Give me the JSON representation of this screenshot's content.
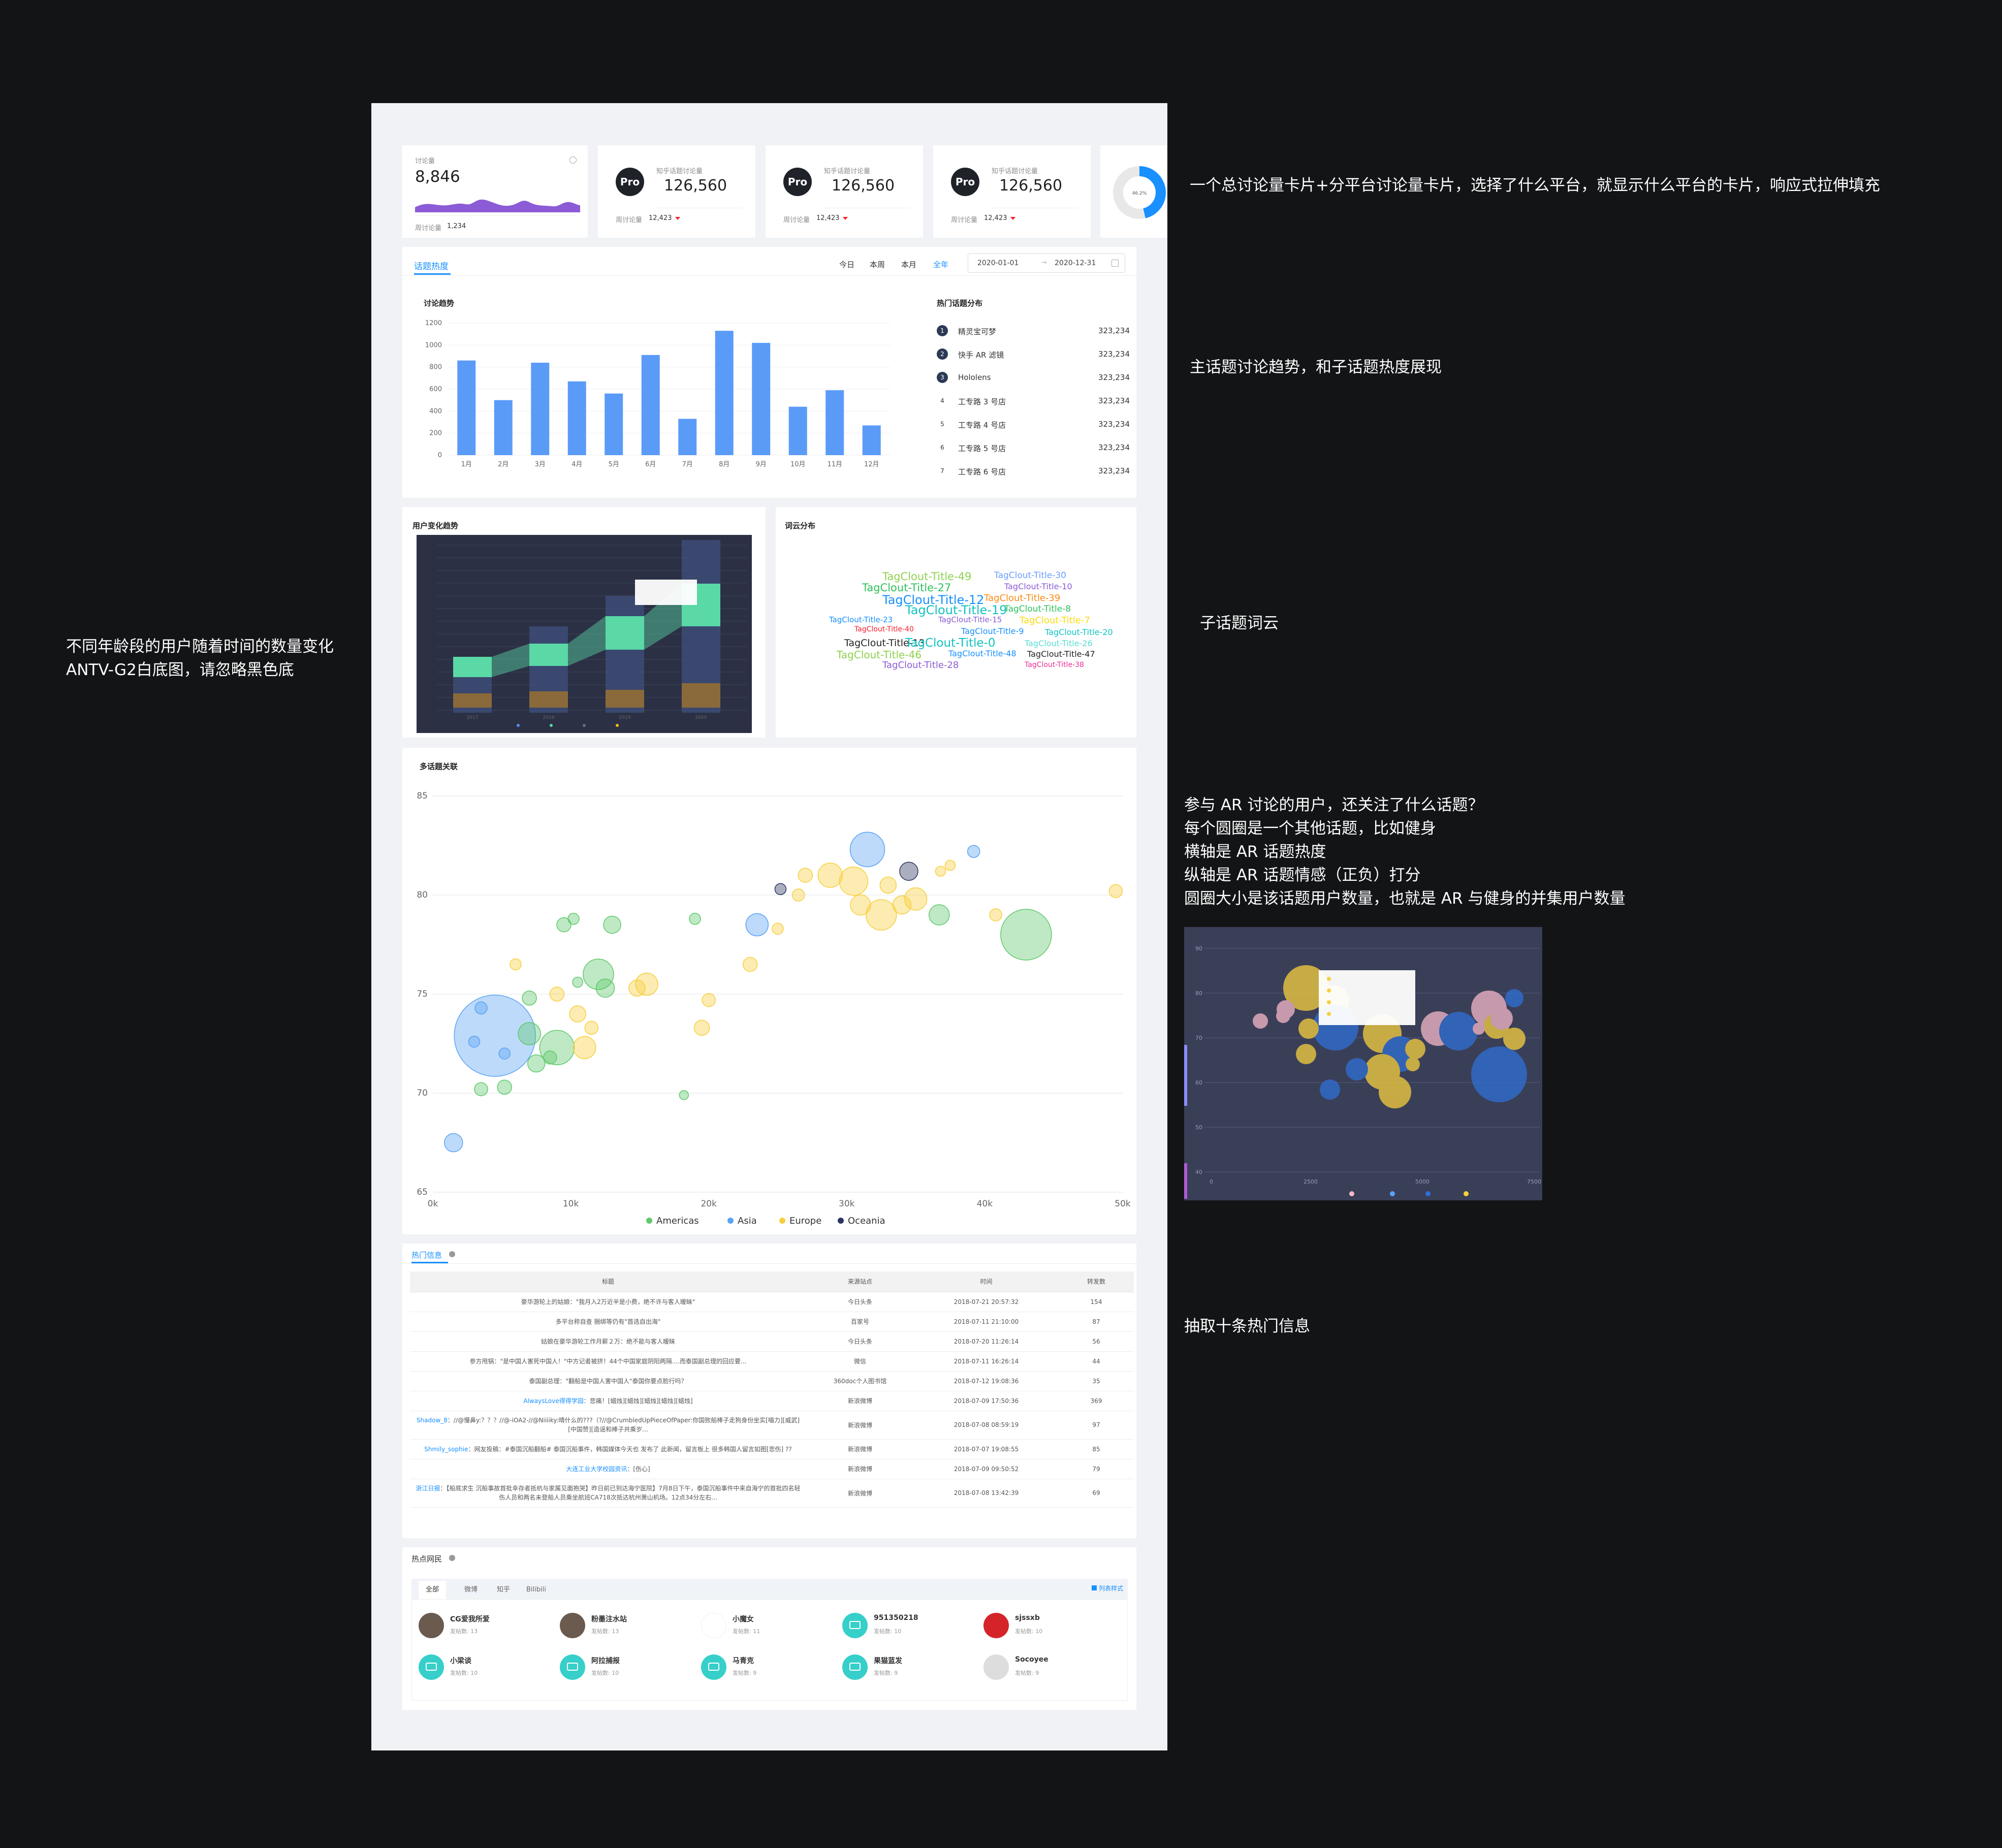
{
  "annotations": {
    "cards_note": "一个总讨论量卡片+分平台讨论量卡片，选择了什么平台，就显示什么平台的卡片，响应式拉伸填充",
    "trend_note": "主话题讨论趋势，和子话题热度展现",
    "user_trend_note": "不同年龄段的用户随着时间的数量变化\nANTV-G2白底图，请忽略黑色底",
    "wordcloud_note": "子话题词云",
    "bubble_note": "参与 AR 讨论的用户，还关注了什么话题？\n每个圆圈是一个其他话题，比如健身\n横轴是 AR 话题热度\n纵轴是 AR 话题情感（正负）打分\n圆圈大小是该话题用户数量，也就是 AR 与健身的并集用户数量",
    "hot_info_note": "抽取十条热门信息"
  },
  "stat_cards": {
    "total": {
      "label": "讨论量",
      "value": "8,846",
      "weekly_label": "周讨论量",
      "weekly_value": "1,234"
    },
    "platforms": [
      {
        "badge": "Pro",
        "label": "知乎话题讨论量",
        "value": "126,560",
        "weekly_label": "周讨论量",
        "weekly_value": "12,423"
      },
      {
        "badge": "Pro",
        "label": "知乎话题讨论量",
        "value": "126,560",
        "weekly_label": "周讨论量",
        "weekly_value": "12,423"
      },
      {
        "badge": "Pro",
        "label": "知乎话题讨论量",
        "value": "126,560",
        "weekly_label": "周讨论量",
        "weekly_value": "12,423"
      }
    ],
    "donut_label": "46.2%",
    "donut_fraction": 0.462
  },
  "topic_heat": {
    "tab": "话题热度",
    "ranges": [
      "今日",
      "本周",
      "本月",
      "全年"
    ],
    "active_range": "全年",
    "date_start": "2020-01-01",
    "date_end": "2020-12-31",
    "date_sep": "→",
    "trend_title": "讨论趋势",
    "rank_title": "热门话题分布",
    "rank": [
      {
        "no": "1",
        "name": "精灵宝可梦",
        "value": "323,234"
      },
      {
        "no": "2",
        "name": "快手 AR 滤镜",
        "value": "323,234"
      },
      {
        "no": "3",
        "name": "Hololens",
        "value": "323,234"
      },
      {
        "no": "4",
        "name": "工专路 3 号店",
        "value": "323,234"
      },
      {
        "no": "5",
        "name": "工专路 4 号店",
        "value": "323,234"
      },
      {
        "no": "6",
        "name": "工专路 5 号店",
        "value": "323,234"
      },
      {
        "no": "7",
        "name": "工专路 6 号店",
        "value": "323,234"
      }
    ]
  },
  "user_trend": {
    "title": "用户变化趋势"
  },
  "wordcloud": {
    "title": "词云分布",
    "words": [
      {
        "text": "TagClout-Title-49",
        "color": "#8fd14f",
        "size": 21
      },
      {
        "text": "TagClout-Title-30",
        "color": "#6b9cff",
        "size": 17
      },
      {
        "text": "TagClout-Title-27",
        "color": "#2fc25b",
        "size": 21
      },
      {
        "text": "TagClout-Title-10",
        "color": "#8c5bd6",
        "size": 16
      },
      {
        "text": "TagClout-Title-12",
        "color": "#1890ff",
        "size": 24
      },
      {
        "text": "TagClout-Title-39",
        "color": "#fa8c16",
        "size": 18
      },
      {
        "text": "TagClout-Title-19",
        "color": "#13c2c2",
        "size": 24
      },
      {
        "text": "TagClout-Title-8",
        "color": "#2fc25b",
        "size": 17
      },
      {
        "text": "TagClout-Title-23",
        "color": "#1890ff",
        "size": 15
      },
      {
        "text": "TagClout-Title-40",
        "color": "#f5222d",
        "size": 14
      },
      {
        "text": "TagClout-Title-15",
        "color": "#8c5bd6",
        "size": 15
      },
      {
        "text": "TagClout-Title-7",
        "color": "#fadb14",
        "size": 18
      },
      {
        "text": "TagClout-Title-13",
        "color": "#222222",
        "size": 19
      },
      {
        "text": "TagClout-Title-9",
        "color": "#1890ff",
        "size": 16
      },
      {
        "text": "TagClout-Title-20",
        "color": "#13c2c2",
        "size": 16
      },
      {
        "text": "TagClout-Title-0",
        "color": "#13c2c2",
        "size": 23
      },
      {
        "text": "TagClout-Title-26",
        "color": "#5cdbd3",
        "size": 16
      },
      {
        "text": "TagClout-Title-46",
        "color": "#8fd14f",
        "size": 20
      },
      {
        "text": "TagClout-Title-48",
        "color": "#1890ff",
        "size": 16
      },
      {
        "text": "TagClout-Title-47",
        "color": "#222222",
        "size": 16
      },
      {
        "text": "TagClout-Title-28",
        "color": "#8c5bd6",
        "size": 18
      },
      {
        "text": "TagClout-Title-38",
        "color": "#eb2f96",
        "size": 14
      }
    ]
  },
  "bubble": {
    "title": "多话题关联"
  },
  "hot_info": {
    "tab": "热门信息",
    "columns": [
      "标题",
      "来源站点",
      "时间",
      "转发数"
    ],
    "rows": [
      {
        "prefix": "",
        "title": "豪华游轮上的姑娘：\"我月入2万近半是小费，绝不许与客人暧昧\"",
        "source": "今日头条",
        "time": "2018-07-21 20:57:32",
        "forwards": "154"
      },
      {
        "prefix": "",
        "title": "多平台称自查 捆绑等仍有\"首选自出海\"",
        "source": "百家号",
        "time": "2018-07-11 21:10:00",
        "forwards": "87"
      },
      {
        "prefix": "",
        "title": "姑娘在豪华游轮工作月薪２万：绝不能与客人暧昧",
        "source": "今日头条",
        "time": "2018-07-20 11:26:14",
        "forwards": "56"
      },
      {
        "prefix": "",
        "title": "参方甩锅：\"是中国人害死中国人！\"中方记者被挤！44个中国家庭阴阳两隔....而泰国副总理的回应要...",
        "source": "微信",
        "time": "2018-07-11 16:26:14",
        "forwards": "44"
      },
      {
        "prefix": "",
        "title": "泰国副总理：\"翻船是中国人害中国人\"泰国你要点脸行吗？",
        "source": "360doc个人图书馆",
        "time": "2018-07-12 19:08:36",
        "forwards": "35"
      },
      {
        "prefix": "AlwaysLove得得学园",
        "title": "：悲痛！[蜡烛][蜡烛][蜡烛][蜡烛][蜡烛]",
        "source": "新浪微博",
        "time": "2018-07-09 17:50:36",
        "forwards": "369"
      },
      {
        "prefix": "Shadow_8",
        "title": "：//@慢鼻y:？？？//@-iOA2-//@Niiiiky:晴什么的???（?//@CrumbledUpPieceOfPaper:你国败船棒子走狗身份坐实[喵力][威武][中国赞][造谣和棒子共乘岁...",
        "source": "新浪微博",
        "time": "2018-07-08 08:59:19",
        "forwards": "97"
      },
      {
        "prefix": "Shmily_sophie",
        "title": "：网友投稿：#泰国沉船翻船# 泰国沉船事件，韩国媒体今天也 发布了 此新闻，留言板上 很多韩国人留言如图[悲伤] ??",
        "source": "新浪微博",
        "time": "2018-07-07 19:08:55",
        "forwards": "85"
      },
      {
        "prefix": "大连工业大学校园资讯",
        "title": "：[伤心]",
        "source": "新浪微博",
        "time": "2018-07-09 09:50:52",
        "forwards": "79"
      },
      {
        "prefix": "浙江日报",
        "title": "：【船底求生 沉船事故首批幸存者抵杭与家属见面抱哭】昨日前已到达海宁医院】7月8日下午，泰国沉船事件中来自海宁的首批四名轻伤人员和两名未登船人员乘坐航班CA718次抵达杭州萧山机场。12点34分左右...",
        "source": "新浪微博",
        "time": "2018-07-08 13:42:39",
        "forwards": "69"
      }
    ]
  },
  "hot_users": {
    "tab": "热点网民",
    "filters": [
      "全部",
      "微博",
      "知乎",
      "Bilibili"
    ],
    "active_filter": "全部",
    "list_style": "列表样式",
    "users": [
      {
        "name": "CG爱我所爱",
        "count": "发帖数: 13",
        "avatar": "photo"
      },
      {
        "name": "粉墨注水站",
        "count": "发帖数: 13",
        "avatar": "photo"
      },
      {
        "name": "小魔女",
        "count": "发帖数: 11",
        "avatar": "logo"
      },
      {
        "name": "951350218",
        "count": "发帖数: 10",
        "avatar": "chat"
      },
      {
        "name": "sjssxb",
        "count": "发帖数: 10",
        "avatar": "red"
      },
      {
        "name": "小梁谈",
        "count": "发帖数: 10",
        "avatar": "chat"
      },
      {
        "name": "阿拉捕报",
        "count": "发帖数: 10",
        "avatar": "chat"
      },
      {
        "name": "马青克",
        "count": "发帖数: 9",
        "avatar": "chat"
      },
      {
        "name": "果猫蓝发",
        "count": "发帖数: 9",
        "avatar": "chat"
      },
      {
        "name": "Socoyee",
        "count": "发帖数: 9",
        "avatar": "gray"
      }
    ]
  },
  "chart_data": [
    {
      "type": "bar",
      "title": "讨论趋势",
      "categories": [
        "1月",
        "2月",
        "3月",
        "4月",
        "5月",
        "6月",
        "7月",
        "8月",
        "9月",
        "10月",
        "11月",
        "12月"
      ],
      "values": [
        860,
        500,
        840,
        670,
        560,
        910,
        330,
        1130,
        1020,
        440,
        590,
        270
      ],
      "ylim": [
        0,
        1200
      ],
      "yticks": [
        0,
        200,
        400,
        600,
        800,
        1000,
        1200
      ],
      "color": "#5b9bf8",
      "grid": true
    },
    {
      "type": "scatter",
      "title": "多话题关联",
      "x_ticks": [
        "0k",
        "10k",
        "20k",
        "30k",
        "40k",
        "50k"
      ],
      "xlim": [
        0,
        50000
      ],
      "ylim": [
        65,
        85
      ],
      "yticks": [
        65,
        70,
        75,
        80,
        85
      ],
      "legend": [
        {
          "name": "Americas",
          "color": "#5ec96b"
        },
        {
          "name": "Asia",
          "color": "#5aa3f5"
        },
        {
          "name": "Europe",
          "color": "#f7cf3e"
        },
        {
          "name": "Oceania",
          "color": "#2b3560"
        }
      ],
      "legend_position": "bottom",
      "points": [
        {
          "x": 4500,
          "y": 72.9,
          "r": 80,
          "g": "Asia"
        },
        {
          "x": 1500,
          "y": 67.5,
          "r": 18,
          "g": "Asia"
        },
        {
          "x": 31500,
          "y": 82.3,
          "r": 34,
          "g": "Asia"
        },
        {
          "x": 23500,
          "y": 78.5,
          "r": 22,
          "g": "Asia"
        },
        {
          "x": 3500,
          "y": 74.3,
          "r": 12,
          "g": "Asia"
        },
        {
          "x": 39200,
          "y": 82.2,
          "r": 12,
          "g": "Asia"
        },
        {
          "x": 3000,
          "y": 72.6,
          "r": 11,
          "g": "Asia"
        },
        {
          "x": 5200,
          "y": 72.0,
          "r": 11,
          "g": "Asia"
        },
        {
          "x": 43000,
          "y": 78.0,
          "r": 50,
          "g": "Americas"
        },
        {
          "x": 12000,
          "y": 76.0,
          "r": 30,
          "g": "Americas"
        },
        {
          "x": 9000,
          "y": 72.3,
          "r": 34,
          "g": "Americas"
        },
        {
          "x": 7000,
          "y": 73.0,
          "r": 22,
          "g": "Americas"
        },
        {
          "x": 13000,
          "y": 78.5,
          "r": 17,
          "g": "Americas"
        },
        {
          "x": 9500,
          "y": 78.5,
          "r": 14,
          "g": "Americas"
        },
        {
          "x": 10200,
          "y": 78.8,
          "r": 11,
          "g": "Americas"
        },
        {
          "x": 12500,
          "y": 75.3,
          "r": 18,
          "g": "Americas"
        },
        {
          "x": 10500,
          "y": 75.6,
          "r": 10,
          "g": "Americas"
        },
        {
          "x": 7000,
          "y": 74.8,
          "r": 14,
          "g": "Americas"
        },
        {
          "x": 5200,
          "y": 70.3,
          "r": 14,
          "g": "Americas"
        },
        {
          "x": 3500,
          "y": 70.2,
          "r": 13,
          "g": "Americas"
        },
        {
          "x": 7500,
          "y": 71.5,
          "r": 17,
          "g": "Americas"
        },
        {
          "x": 8500,
          "y": 71.8,
          "r": 13,
          "g": "Americas"
        },
        {
          "x": 36700,
          "y": 79.0,
          "r": 20,
          "g": "Americas"
        },
        {
          "x": 19000,
          "y": 78.8,
          "r": 11,
          "g": "Americas"
        },
        {
          "x": 18200,
          "y": 69.9,
          "r": 9,
          "g": "Americas"
        },
        {
          "x": 35000,
          "y": 79.8,
          "r": 22,
          "g": "Europe"
        },
        {
          "x": 32500,
          "y": 79.0,
          "r": 30,
          "g": "Europe"
        },
        {
          "x": 30500,
          "y": 80.7,
          "r": 28,
          "g": "Europe"
        },
        {
          "x": 28800,
          "y": 81.0,
          "r": 24,
          "g": "Europe"
        },
        {
          "x": 31000,
          "y": 79.5,
          "r": 20,
          "g": "Europe"
        },
        {
          "x": 33000,
          "y": 80.5,
          "r": 16,
          "g": "Europe"
        },
        {
          "x": 34000,
          "y": 79.5,
          "r": 18,
          "g": "Europe"
        },
        {
          "x": 27000,
          "y": 81.0,
          "r": 14,
          "g": "Europe"
        },
        {
          "x": 26500,
          "y": 80.0,
          "r": 12,
          "g": "Europe"
        },
        {
          "x": 15500,
          "y": 75.5,
          "r": 22,
          "g": "Europe"
        },
        {
          "x": 14800,
          "y": 75.3,
          "r": 16,
          "g": "Europe"
        },
        {
          "x": 9000,
          "y": 75.0,
          "r": 14,
          "g": "Europe"
        },
        {
          "x": 10500,
          "y": 74.0,
          "r": 16,
          "g": "Europe"
        },
        {
          "x": 11000,
          "y": 72.3,
          "r": 22,
          "g": "Europe"
        },
        {
          "x": 11500,
          "y": 73.3,
          "r": 13,
          "g": "Europe"
        },
        {
          "x": 20000,
          "y": 74.7,
          "r": 13,
          "g": "Europe"
        },
        {
          "x": 19500,
          "y": 73.3,
          "r": 15,
          "g": "Europe"
        },
        {
          "x": 23000,
          "y": 76.5,
          "r": 14,
          "g": "Europe"
        },
        {
          "x": 25000,
          "y": 78.3,
          "r": 11,
          "g": "Europe"
        },
        {
          "x": 40800,
          "y": 79.0,
          "r": 12,
          "g": "Europe"
        },
        {
          "x": 49500,
          "y": 80.2,
          "r": 13,
          "g": "Europe"
        },
        {
          "x": 6000,
          "y": 76.5,
          "r": 11,
          "g": "Europe"
        },
        {
          "x": 36800,
          "y": 81.2,
          "r": 10,
          "g": "Europe"
        },
        {
          "x": 37500,
          "y": 81.5,
          "r": 10,
          "g": "Europe"
        },
        {
          "x": 34500,
          "y": 81.2,
          "r": 18,
          "g": "Oceania"
        },
        {
          "x": 25200,
          "y": 80.3,
          "r": 11,
          "g": "Oceania"
        }
      ]
    }
  ]
}
